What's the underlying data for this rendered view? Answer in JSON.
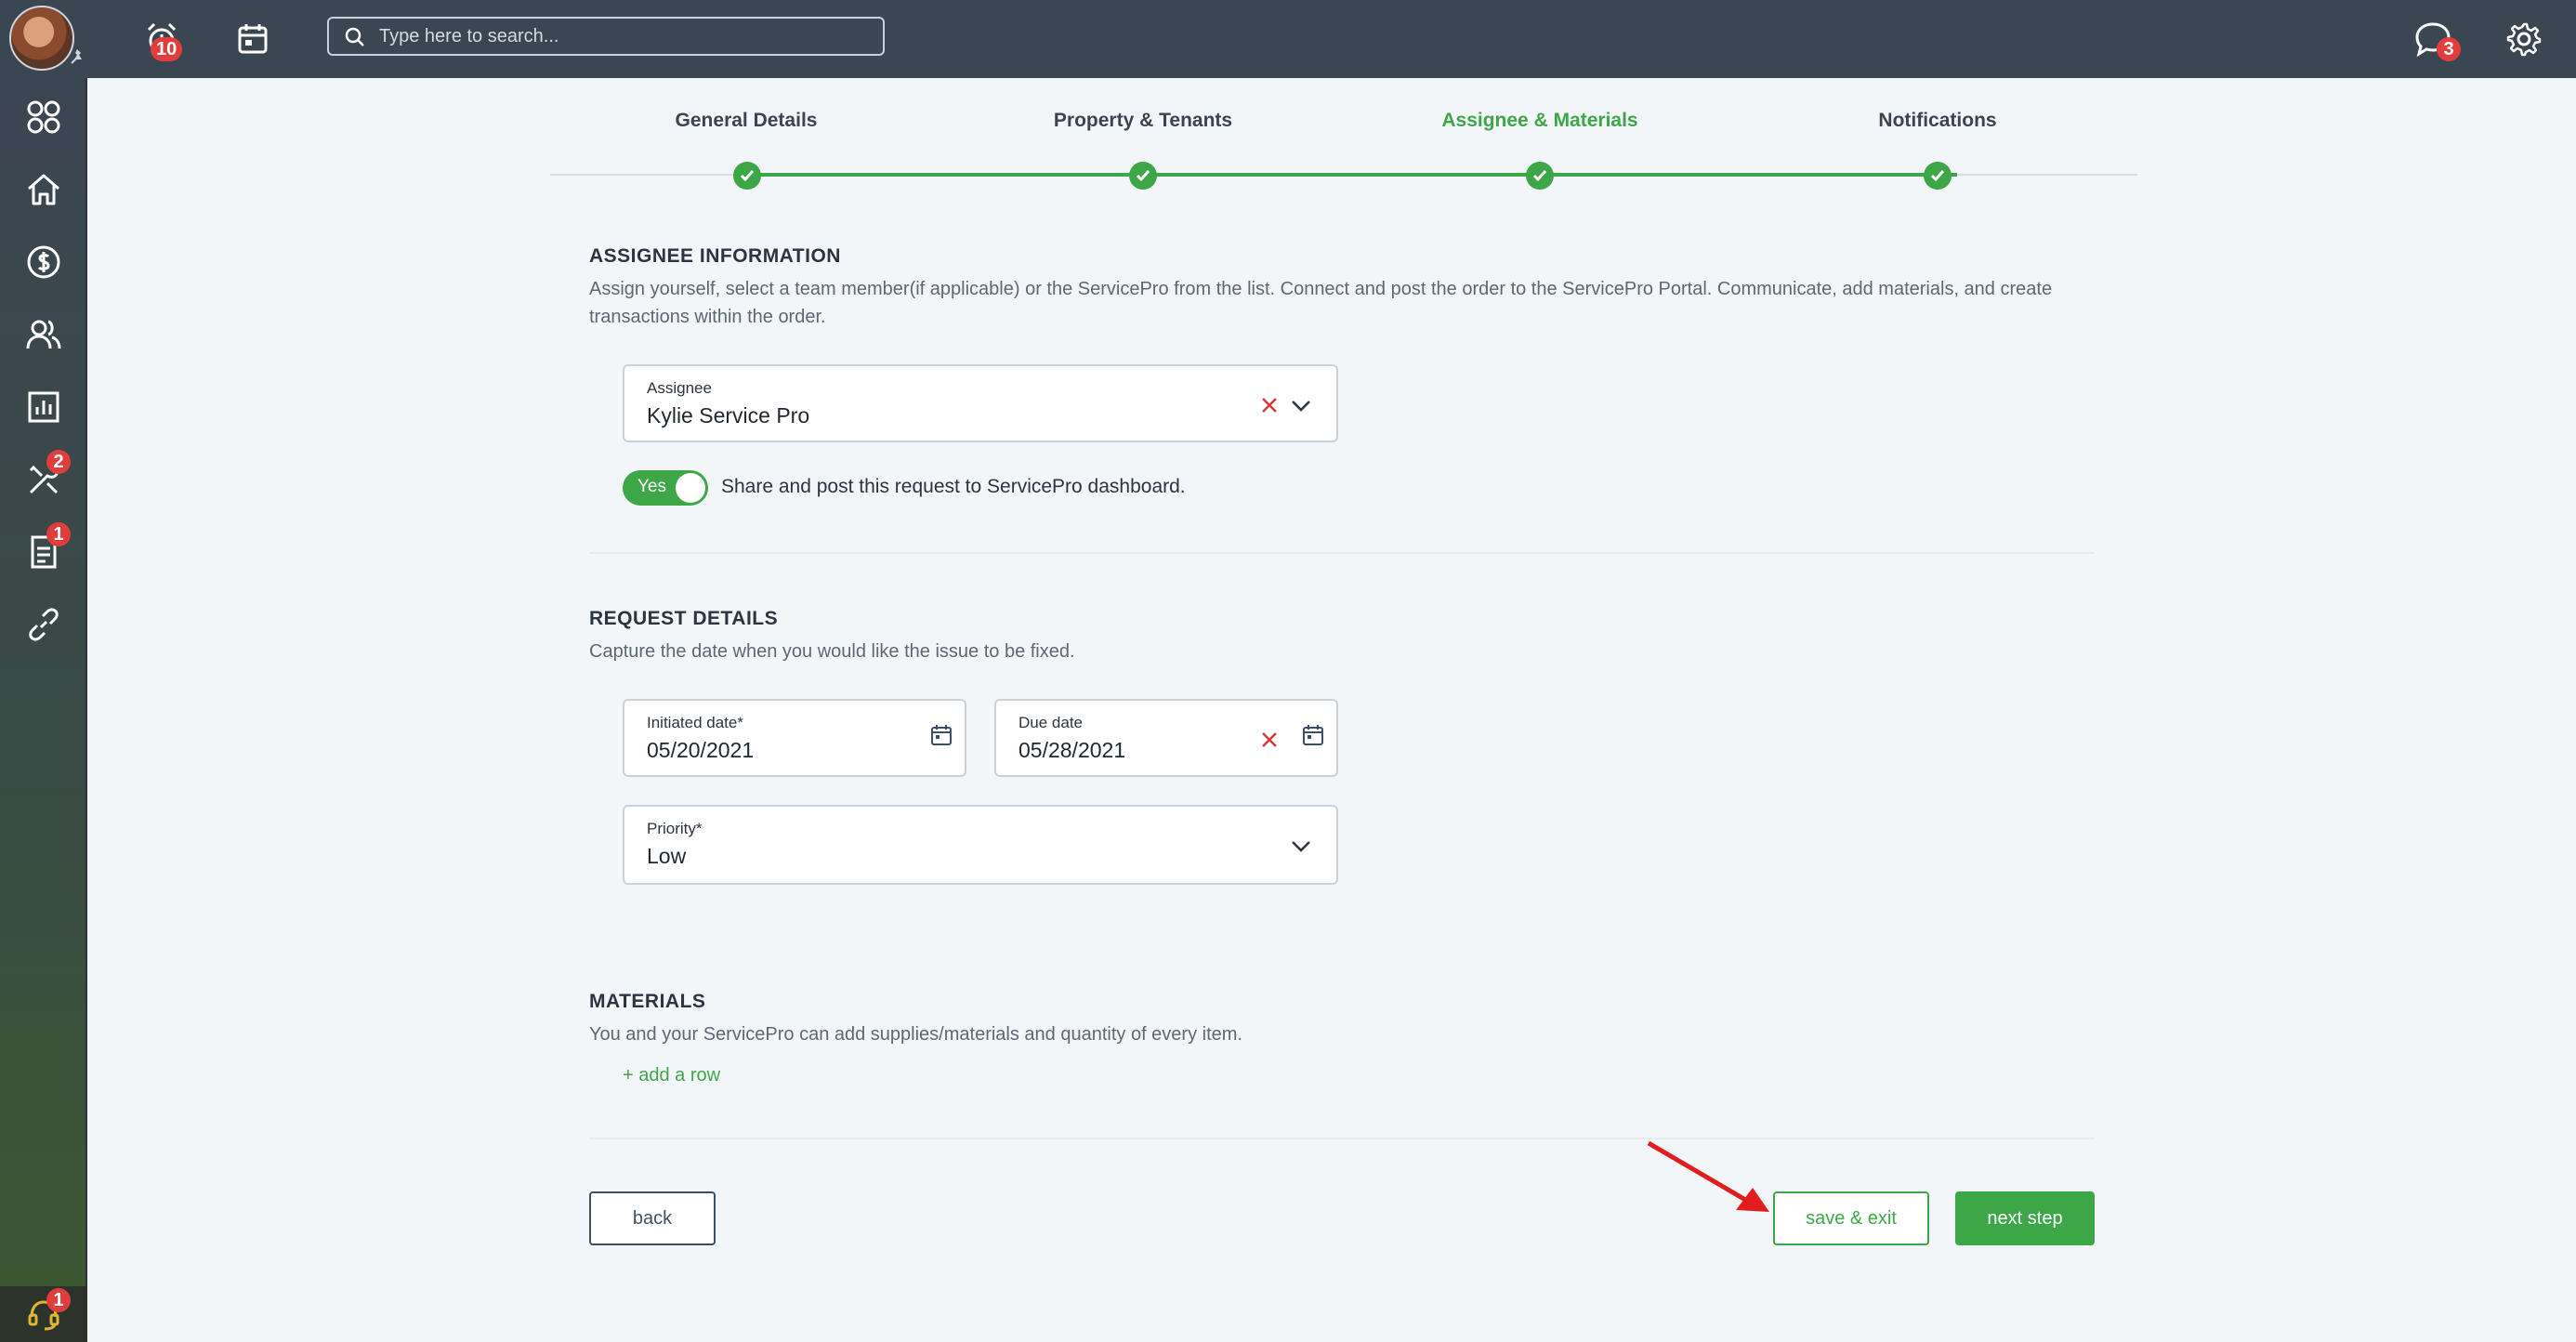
{
  "topbar": {
    "alerts_badge": "10",
    "search_placeholder": "Type here to search...",
    "messages_badge": "3"
  },
  "sidebar": {
    "items": [
      {
        "icon": "grid-icon"
      },
      {
        "icon": "home-icon"
      },
      {
        "icon": "dollar-icon"
      },
      {
        "icon": "people-icon"
      },
      {
        "icon": "chart-icon"
      },
      {
        "icon": "tools-icon",
        "badge": "2"
      },
      {
        "icon": "document-icon",
        "badge": "1"
      },
      {
        "icon": "link-icon"
      }
    ],
    "help_badge": "1"
  },
  "stepper": {
    "steps": [
      {
        "label": "General Details",
        "active": false
      },
      {
        "label": "Property & Tenants",
        "active": false
      },
      {
        "label": "Assignee & Materials",
        "active": true
      },
      {
        "label": "Notifications",
        "active": false
      }
    ]
  },
  "assignee": {
    "title": "ASSIGNEE INFORMATION",
    "description": "Assign yourself, select a team member(if applicable) or the ServicePro from the list. Connect and post the order to the ServicePro Portal. Communicate, add materials, and create transactions within the order.",
    "field_label": "Assignee",
    "field_value": "Kylie Service Pro",
    "toggle_label": "Yes",
    "toggle_text": "Share and post this request to ServicePro dashboard."
  },
  "request": {
    "title": "REQUEST DETAILS",
    "description": "Capture the date when you would like the issue to be fixed.",
    "initiated_label": "Initiated date*",
    "initiated_value": "05/20/2021",
    "due_label": "Due date",
    "due_value": "05/28/2021",
    "priority_label": "Priority*",
    "priority_value": "Low"
  },
  "materials": {
    "title": "MATERIALS",
    "description": "You and your ServicePro can add supplies/materials and quantity of every item.",
    "add_row": "+ add a row"
  },
  "actions": {
    "back": "back",
    "save_exit": "save & exit",
    "next_step": "next step"
  },
  "colors": {
    "accent": "#3da748",
    "topbar": "#3b4653",
    "danger": "#e23d3d"
  }
}
